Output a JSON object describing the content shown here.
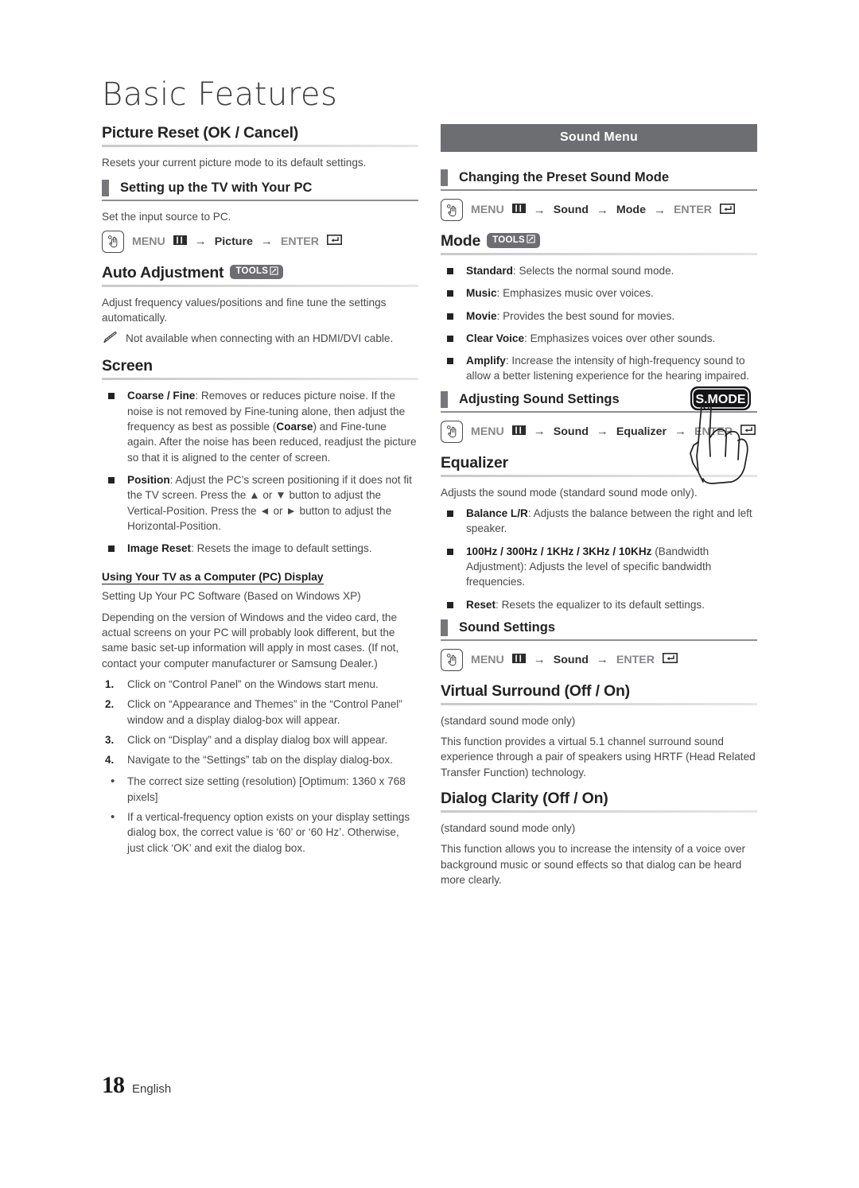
{
  "document": {
    "title": "Basic Features",
    "footer": {
      "page_number": "18",
      "language": "English"
    }
  },
  "colors": {
    "banner_bg": "#6d6e71",
    "subhead_bar": "#77777b",
    "tools_badge_bg": "#6e6e72",
    "bullet": "#232325",
    "text": "#48484a",
    "heading": "#232325"
  },
  "left_column": {
    "picture_reset": {
      "heading": "Picture Reset (OK / Cancel)",
      "body": "Resets your current picture mode to its default settings."
    },
    "setting_up_pc": {
      "subheading": "Setting up the TV with Your PC",
      "body": "Set the input source to PC.",
      "menu_path": {
        "icon": "hand-press-icon",
        "menu_label": "MENU",
        "menu_glyph": "menu-bars-icon",
        "arrow": "→",
        "step1": "Picture",
        "enter_label": "ENTER",
        "enter_glyph": "enter-key-icon"
      }
    },
    "auto_adjustment": {
      "heading": "Auto Adjustment",
      "badge": "TOOLS",
      "badge_glyph": "tools-arrow-icon",
      "body": "Adjust frequency values/positions and fine tune the settings automatically.",
      "note_icon": "pencil-note-icon",
      "note": "Not available when connecting with an HDMI/DVI cable."
    },
    "screen": {
      "heading": "Screen",
      "items": [
        {
          "label": "Coarse / Fine",
          "text": ": Removes or reduces picture noise. If the noise is not removed by Fine-tuning alone, then adjust the frequency as best as possible (",
          "inline_bold": "Coarse",
          "text2": ") and Fine-tune again. After the noise has been reduced, readjust the picture so that it is aligned to the center of screen."
        },
        {
          "label": "Position",
          "text": ": Adjust the PC’s screen positioning if it does not fit the TV screen. Press the ▲ or ▼ button to adjust the Vertical-Position. Press the ◄ or ► button to adjust the Horizontal-Position."
        },
        {
          "label": "Image Reset",
          "text": ": Resets the image to default settings."
        }
      ]
    },
    "pc_display": {
      "heading": "Using Your TV as a Computer (PC) Display",
      "subtitle": "Setting Up Your PC Software (Based on Windows XP)",
      "body": "Depending on the version of Windows and the video card, the actual screens on your PC will probably look different, but the same basic set-up information will apply in most cases. (If not, contact your computer manufacturer or Samsung Dealer.)",
      "steps": [
        "Click on “Control Panel” on the Windows start menu.",
        "Click on “Appearance and Themes” in the “Control Panel” window and a display dialog-box will appear.",
        "Click on “Display” and a display dialog box will appear.",
        "Navigate to the “Settings” tab on the display dialog-box."
      ],
      "bullets": [
        "The correct size setting (resolution) [Optimum: 1360 x 768 pixels]",
        "If a vertical-frequency option exists on your display settings dialog box, the correct value is ‘60’ or ‘60 Hz’. Otherwise, just click ‘OK’ and exit the dialog box."
      ]
    }
  },
  "right_column": {
    "banner": "Sound Menu",
    "preset_sound_mode": {
      "subheading": "Changing the Preset Sound Mode",
      "menu_path": {
        "icon": "hand-press-icon",
        "menu_label": "MENU",
        "menu_glyph": "menu-bars-icon",
        "arrow": "→",
        "step1": "Sound",
        "step2": "Mode",
        "enter_label": "ENTER",
        "enter_glyph": "enter-key-icon"
      }
    },
    "mode": {
      "heading": "Mode",
      "badge": "TOOLS",
      "badge_glyph": "tools-arrow-icon",
      "remote_button": {
        "label": "S.MODE",
        "icon": "hand-pressing-remote-button-illustration"
      },
      "items": [
        {
          "label": "Standard",
          "text": ": Selects the normal sound mode."
        },
        {
          "label": "Music",
          "text": ": Emphasizes music over voices."
        },
        {
          "label": "Movie",
          "text": ": Provides the best sound for movies."
        },
        {
          "label": "Clear Voice",
          "text": ": Emphasizes voices over other sounds."
        },
        {
          "label": "Amplify",
          "text": ": Increase the intensity of high-frequency sound to allow a better listening experience for the hearing impaired."
        }
      ]
    },
    "adjusting_sound_settings": {
      "subheading": "Adjusting Sound Settings",
      "menu_path": {
        "icon": "hand-press-icon",
        "menu_label": "MENU",
        "menu_glyph": "menu-bars-icon",
        "arrow": "→",
        "step1": "Sound",
        "step2": "Equalizer",
        "enter_label": "ENTER",
        "enter_glyph": "enter-key-icon"
      }
    },
    "equalizer": {
      "heading": "Equalizer",
      "body": "Adjusts the sound mode (standard sound mode only).",
      "items": [
        {
          "label": "Balance L/R",
          "text": ": Adjusts the balance between the right and left speaker."
        },
        {
          "label": "100Hz / 300Hz / 1KHz / 3KHz / 10KHz",
          "text": " (Bandwidth Adjustment): Adjusts the level of specific bandwidth frequencies."
        },
        {
          "label": "Reset",
          "text": ": Resets the equalizer to its default settings."
        }
      ]
    },
    "sound_settings": {
      "subheading": "Sound Settings",
      "menu_path": {
        "icon": "hand-press-icon",
        "menu_label": "MENU",
        "menu_glyph": "menu-bars-icon",
        "arrow": "→",
        "step1": "Sound",
        "enter_label": "ENTER",
        "enter_glyph": "enter-key-icon"
      }
    },
    "virtual_surround": {
      "heading": "Virtual Surround (Off / On)",
      "note": "(standard sound mode only)",
      "body": "This function provides a virtual 5.1 channel surround sound experience through a pair of speakers using HRTF (Head Related Transfer Function) technology."
    },
    "dialog_clarity": {
      "heading": "Dialog Clarity (Off / On)",
      "note": "(standard sound mode only)",
      "body": "This function allows you to increase the intensity of a voice over background music or sound effects so that dialog can be heard more clearly."
    }
  }
}
